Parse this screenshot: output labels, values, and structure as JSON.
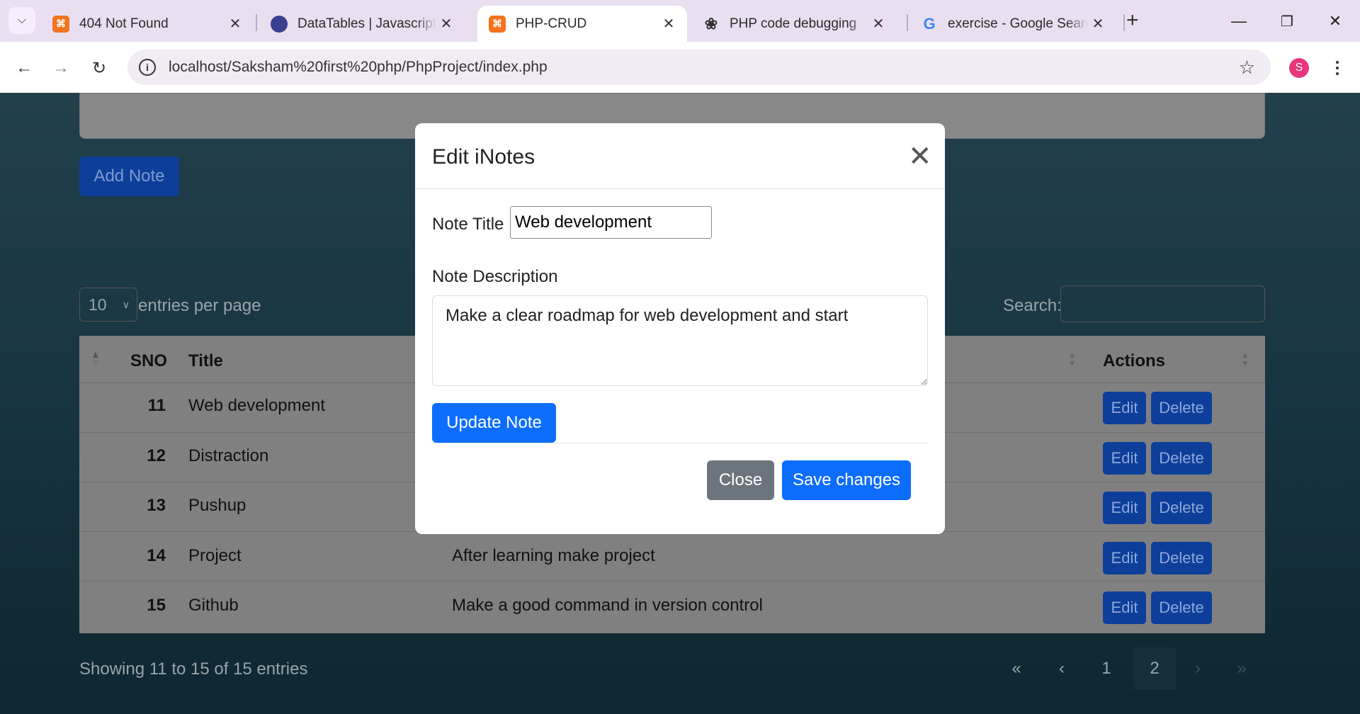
{
  "browser": {
    "tabs": [
      {
        "title": "404 Not Found",
        "favicon": "xampp-icon"
      },
      {
        "title": "DataTables | Javascript table library",
        "favicon": "datatables-icon"
      },
      {
        "title": "PHP-CRUD",
        "favicon": "xampp-icon",
        "active": true
      },
      {
        "title": "PHP code debugging",
        "favicon": "chatgpt-icon"
      },
      {
        "title": "exercise - Google Search",
        "favicon": "google-icon"
      }
    ],
    "url": "localhost/Saksham%20first%20php/PhpProject/index.php",
    "profile_initial": "S"
  },
  "page": {
    "add_note_label": "Add Note",
    "length_value": "10",
    "length_label": "entries per page",
    "search_label": "Search:",
    "columns": {
      "sno": "SNO",
      "title": "Title",
      "actions": "Actions"
    },
    "rows": [
      {
        "sno": "11",
        "title": "Web development",
        "description": ""
      },
      {
        "sno": "12",
        "title": "Distraction",
        "description": ""
      },
      {
        "sno": "13",
        "title": "Pushup",
        "description": ""
      },
      {
        "sno": "14",
        "title": "Project",
        "description": "After learning make project"
      },
      {
        "sno": "15",
        "title": "Github",
        "description": "Make a good command in version control"
      }
    ],
    "edit_label": "Edit",
    "delete_label": "Delete",
    "info": "Showing 11 to 15 of 15 entries",
    "pagination": {
      "first": "«",
      "prev": "‹",
      "pages": [
        "1",
        "2"
      ],
      "current": "2",
      "next": "›",
      "last": "»"
    }
  },
  "modal": {
    "title": "Edit iNotes",
    "note_title_label": "Note Title",
    "note_title_value": "Web development",
    "note_desc_label": "Note Description",
    "note_desc_value": "Make a clear roadmap for web development and start",
    "update_label": "Update Note",
    "close_label": "Close",
    "save_label": "Save changes"
  },
  "colors": {
    "primary": "#0d6efd",
    "secondary": "#6c757d",
    "profile": "#e8357e"
  }
}
